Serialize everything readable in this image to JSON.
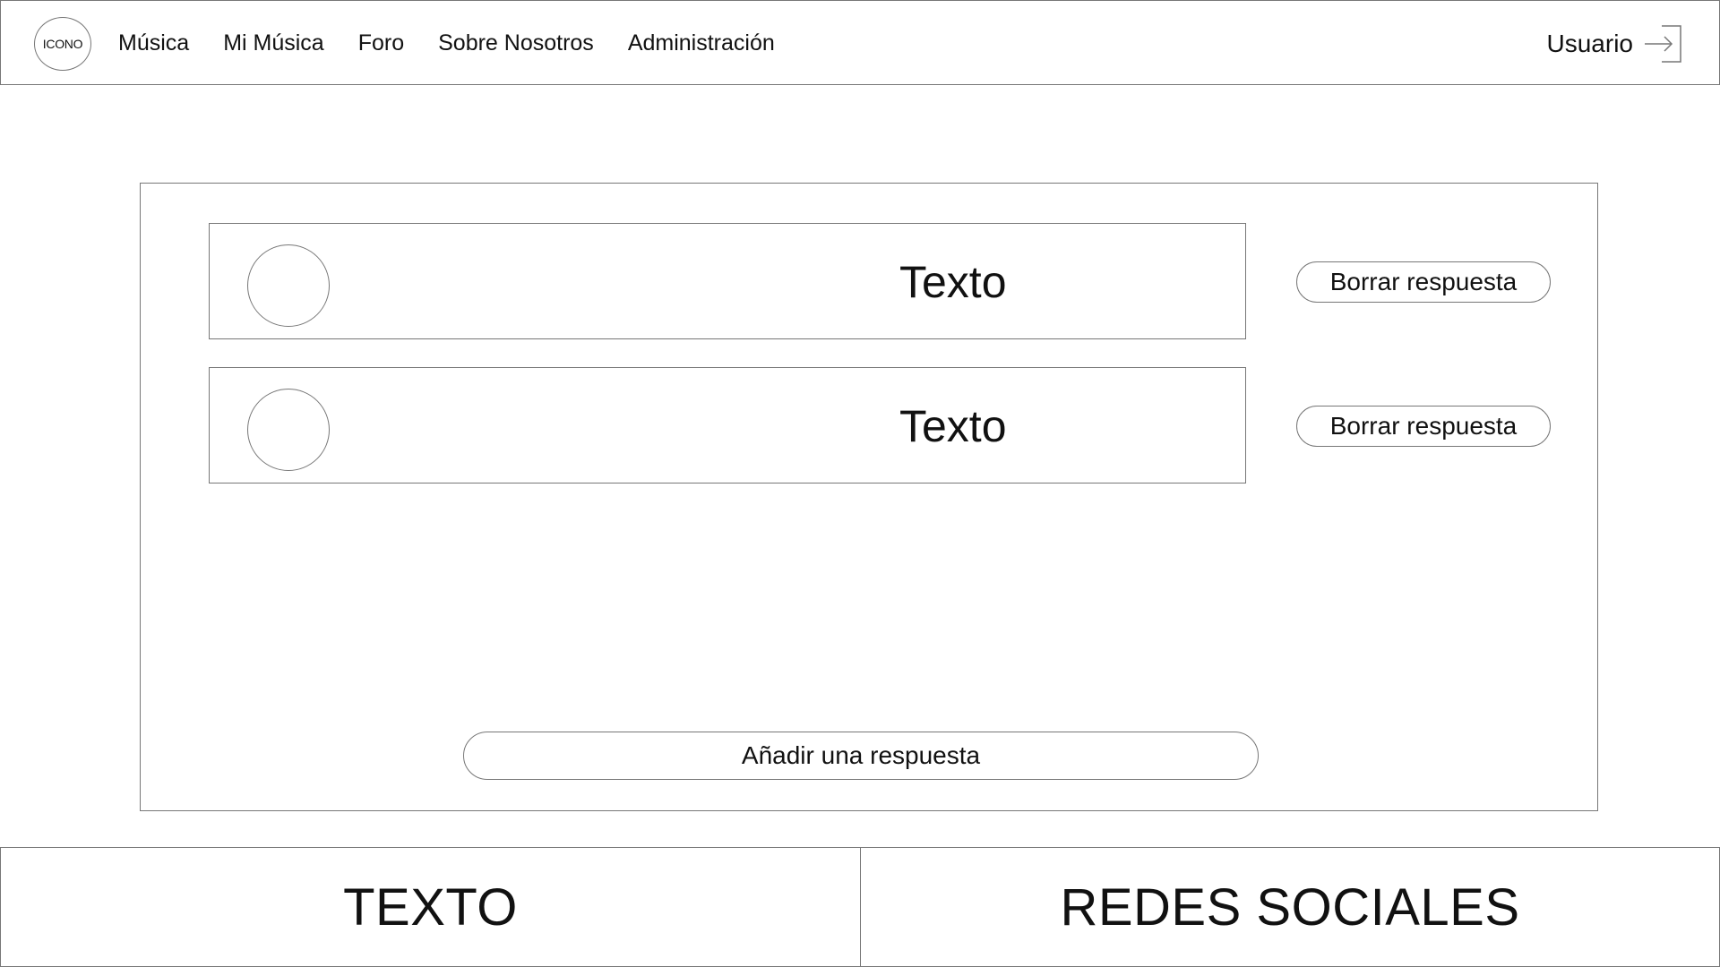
{
  "header": {
    "logo_text": "ICONO",
    "nav_items": [
      "Música",
      "Mi Música",
      "Foro",
      "Sobre Nosotros",
      "Administración"
    ],
    "user_label": "Usuario",
    "logout_icon": "logout-arrow-icon"
  },
  "main": {
    "responses": [
      {
        "text": "Texto",
        "delete_label": "Borrar respuesta"
      },
      {
        "text": "Texto",
        "delete_label": "Borrar respuesta"
      }
    ],
    "add_response_label": "Añadir una respuesta"
  },
  "footer": {
    "left_text": "TEXTO",
    "right_text": "REDES SOCIALES"
  }
}
